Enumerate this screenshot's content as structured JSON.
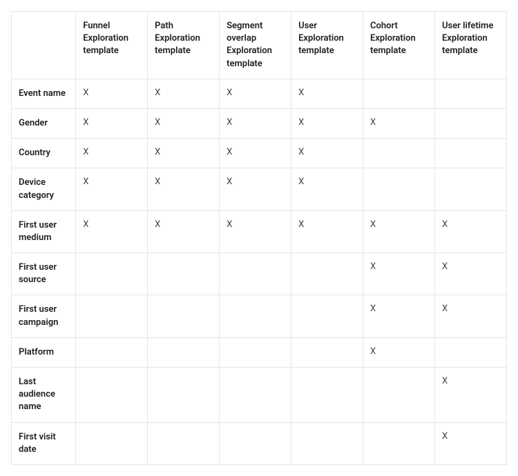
{
  "chart_data": {
    "type": "table",
    "columns": [
      "Funnel Exploration template",
      "Path Exploration template",
      "Segment overlap Exploration template",
      "User Exploration template",
      "Cohort Exploration template",
      "User lifetime Exploration template"
    ],
    "rows": [
      "Event name",
      "Gender",
      "Country",
      "Device category",
      "First user medium",
      "First user source",
      "First user campaign",
      "Platform",
      "Last audience name",
      "First visit date"
    ],
    "mark": "X",
    "cells": [
      [
        "X",
        "X",
        "X",
        "X",
        "",
        ""
      ],
      [
        "X",
        "X",
        "X",
        "X",
        "X",
        ""
      ],
      [
        "X",
        "X",
        "X",
        "X",
        "",
        ""
      ],
      [
        "X",
        "X",
        "X",
        "X",
        "",
        ""
      ],
      [
        "X",
        "X",
        "X",
        "X",
        "X",
        "X"
      ],
      [
        "",
        "",
        "",
        "",
        "X",
        "X"
      ],
      [
        "",
        "",
        "",
        "",
        "X",
        "X"
      ],
      [
        "",
        "",
        "",
        "",
        "X",
        ""
      ],
      [
        "",
        "",
        "",
        "",
        "",
        "X"
      ],
      [
        "",
        "",
        "",
        "",
        "",
        "X"
      ]
    ]
  }
}
